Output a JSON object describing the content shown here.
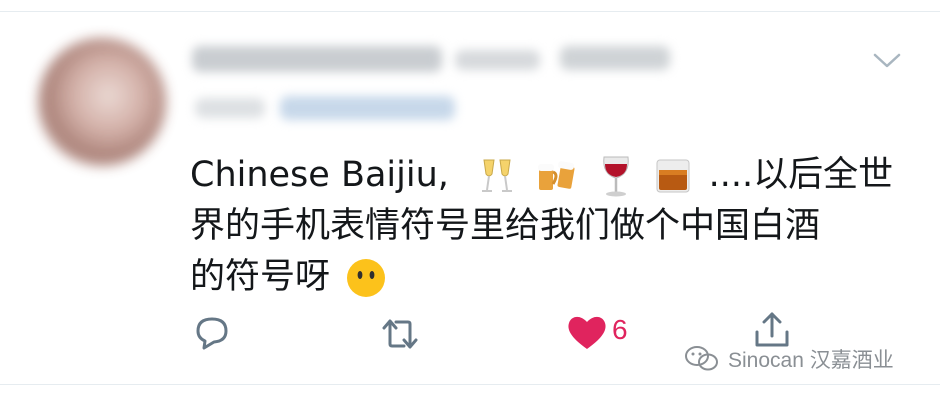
{
  "tweet": {
    "text_lines": [
      "Chinese Baijiu,",
      "....以后全世",
      "界的手机表情符号里给我们做个中国白酒",
      "的符号呀"
    ],
    "emojis": [
      "champagne-glasses",
      "beer-mugs",
      "wine-glass",
      "whisky-glass",
      "hushed-face"
    ]
  },
  "actions": {
    "like_count": "6",
    "like_color": "#e0245e"
  },
  "watermark": {
    "text": "Sinocan 汉嘉酒业"
  }
}
